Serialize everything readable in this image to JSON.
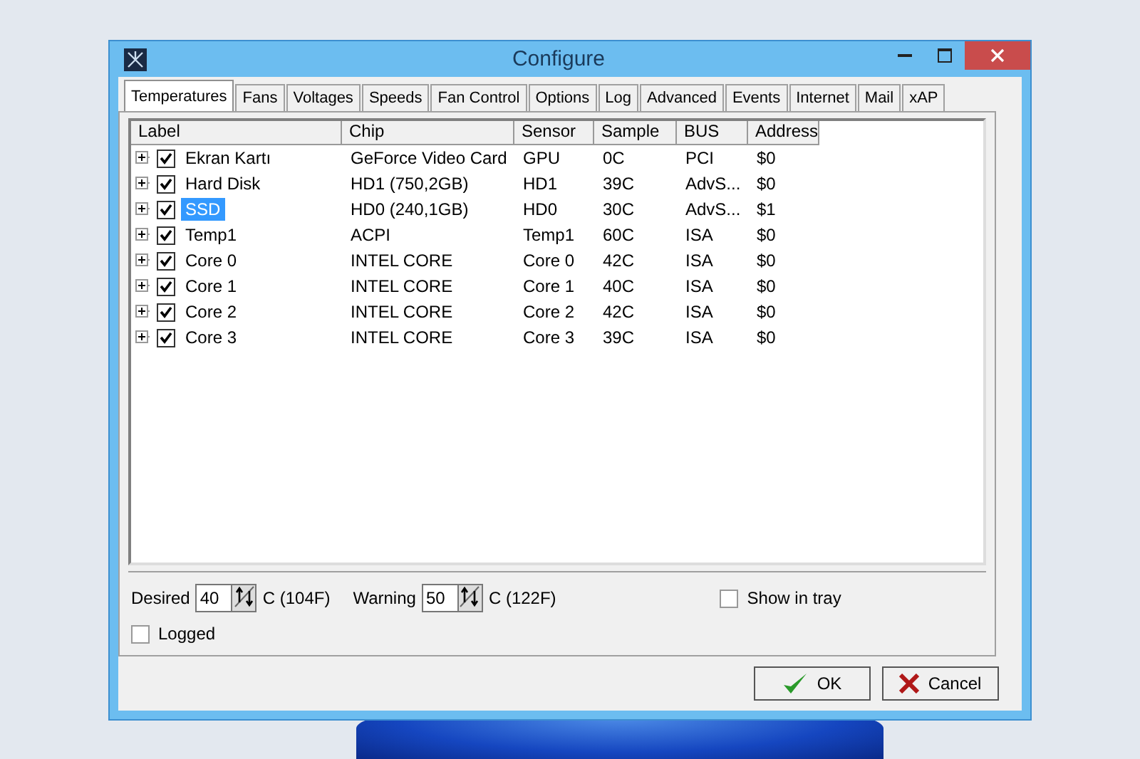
{
  "window": {
    "title": "Configure"
  },
  "tabs": [
    {
      "label": "Temperatures",
      "selected": true
    },
    {
      "label": "Fans",
      "selected": false
    },
    {
      "label": "Voltages",
      "selected": false
    },
    {
      "label": "Speeds",
      "selected": false
    },
    {
      "label": "Fan Control",
      "selected": false
    },
    {
      "label": "Options",
      "selected": false
    },
    {
      "label": "Log",
      "selected": false
    },
    {
      "label": "Advanced",
      "selected": false
    },
    {
      "label": "Events",
      "selected": false
    },
    {
      "label": "Internet",
      "selected": false
    },
    {
      "label": "Mail",
      "selected": false
    },
    {
      "label": "xAP",
      "selected": false
    }
  ],
  "table": {
    "columns": [
      "Label",
      "Chip",
      "Sensor",
      "Sample",
      "BUS",
      "Address"
    ],
    "rows": [
      {
        "label": "Ekran Kartı",
        "checked": true,
        "selected": false,
        "chip": "GeForce Video Card",
        "sensor": "GPU",
        "sample": "0C",
        "bus": "PCI",
        "address": "$0"
      },
      {
        "label": "Hard Disk",
        "checked": true,
        "selected": false,
        "chip": "HD1 (750,2GB)",
        "sensor": "HD1",
        "sample": "39C",
        "bus": "AdvS...",
        "address": "$0"
      },
      {
        "label": "SSD",
        "checked": true,
        "selected": true,
        "chip": "HD0 (240,1GB)",
        "sensor": "HD0",
        "sample": "30C",
        "bus": "AdvS...",
        "address": "$1"
      },
      {
        "label": "Temp1",
        "checked": true,
        "selected": false,
        "chip": "ACPI",
        "sensor": "Temp1",
        "sample": "60C",
        "bus": "ISA",
        "address": "$0"
      },
      {
        "label": "Core 0",
        "checked": true,
        "selected": false,
        "chip": "INTEL CORE",
        "sensor": "Core 0",
        "sample": "42C",
        "bus": "ISA",
        "address": "$0"
      },
      {
        "label": "Core 1",
        "checked": true,
        "selected": false,
        "chip": "INTEL CORE",
        "sensor": "Core 1",
        "sample": "40C",
        "bus": "ISA",
        "address": "$0"
      },
      {
        "label": "Core 2",
        "checked": true,
        "selected": false,
        "chip": "INTEL CORE",
        "sensor": "Core 2",
        "sample": "42C",
        "bus": "ISA",
        "address": "$0"
      },
      {
        "label": "Core 3",
        "checked": true,
        "selected": false,
        "chip": "INTEL CORE",
        "sensor": "Core 3",
        "sample": "39C",
        "bus": "ISA",
        "address": "$0"
      }
    ]
  },
  "settings": {
    "desired": {
      "label": "Desired",
      "value": "40",
      "unit": "C (104F)"
    },
    "warning": {
      "label": "Warning",
      "value": "50",
      "unit": "C (122F)"
    },
    "show_in_tray": {
      "label": "Show in tray",
      "checked": false
    },
    "logged": {
      "label": "Logged",
      "checked": false
    }
  },
  "buttons": [
    {
      "label": "OK",
      "kind": "ok"
    },
    {
      "label": "Cancel",
      "kind": "cancel"
    }
  ]
}
